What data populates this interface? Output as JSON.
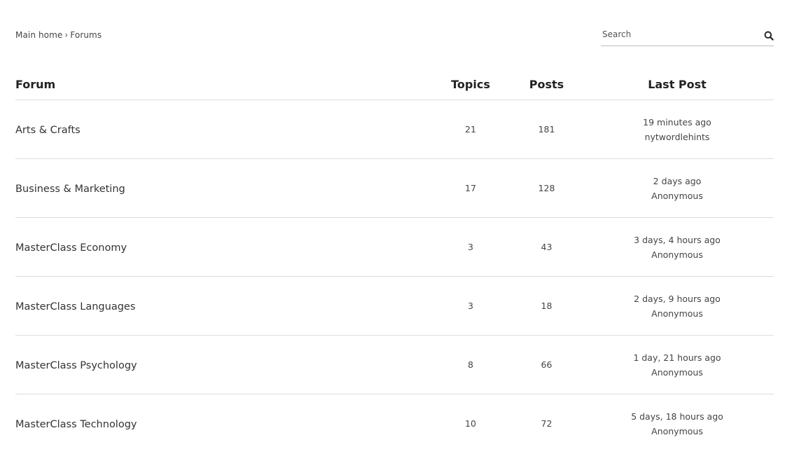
{
  "breadcrumb": {
    "home": "Main home",
    "separator": "›",
    "current": "Forums"
  },
  "search": {
    "placeholder": "Search",
    "value": "",
    "icon": "search-icon"
  },
  "table": {
    "headers": {
      "forum": "Forum",
      "topics": "Topics",
      "posts": "Posts",
      "last_post": "Last Post"
    },
    "rows": [
      {
        "name": "Arts & Crafts",
        "topics": "21",
        "posts": "181",
        "last_time": "19 minutes ago",
        "last_author": "nytwordlehints"
      },
      {
        "name": "Business & Marketing",
        "topics": "17",
        "posts": "128",
        "last_time": "2 days ago",
        "last_author": "Anonymous"
      },
      {
        "name": "MasterClass Economy",
        "topics": "3",
        "posts": "43",
        "last_time": "3 days, 4 hours ago",
        "last_author": "Anonymous"
      },
      {
        "name": "MasterClass Languages",
        "topics": "3",
        "posts": "18",
        "last_time": "2 days, 9 hours ago",
        "last_author": "Anonymous"
      },
      {
        "name": "MasterClass Psychology",
        "topics": "8",
        "posts": "66",
        "last_time": "1 day, 21 hours ago",
        "last_author": "Anonymous"
      },
      {
        "name": "MasterClass Technology",
        "topics": "10",
        "posts": "72",
        "last_time": "5 days, 18 hours ago",
        "last_author": "Anonymous"
      }
    ]
  }
}
